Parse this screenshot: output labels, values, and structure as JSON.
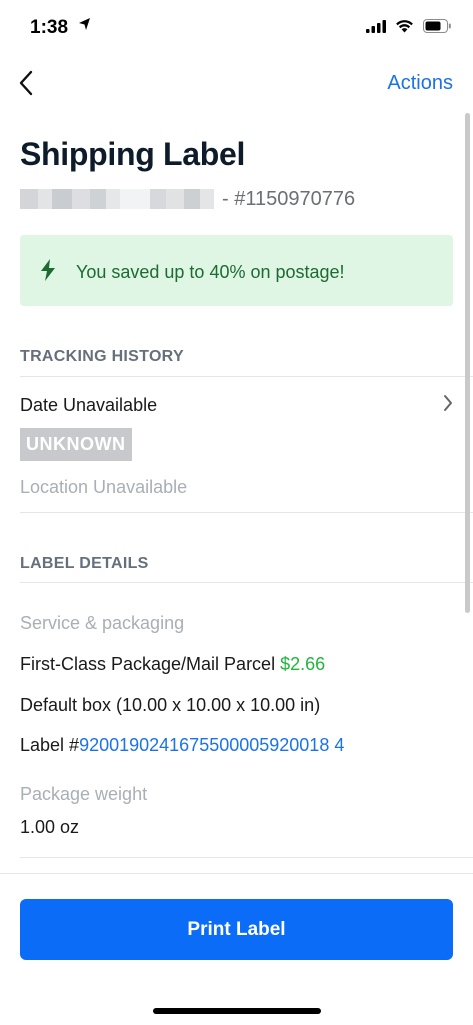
{
  "status_bar": {
    "time": "1:38"
  },
  "nav": {
    "actions_label": "Actions"
  },
  "header": {
    "title": "Shipping Label",
    "order_number": "- #1150970776"
  },
  "banner": {
    "text": "You saved up to 40% on postage!"
  },
  "tracking": {
    "heading": "TRACKING HISTORY",
    "date": "Date Unavailable",
    "status_badge": "UNKNOWN",
    "location": "Location Unavailable"
  },
  "label_details": {
    "heading": "LABEL DETAILS",
    "service_heading": "Service & packaging",
    "service_name": "First-Class Package/Mail Parcel",
    "service_price": "$2.66",
    "box": "Default box (10.00 x 10.00 x 10.00 in)",
    "label_prefix": "Label #",
    "label_number": "9200190241675500005920018 4",
    "weight_heading": "Package weight",
    "weight_value": "1.00 oz"
  },
  "footer": {
    "print_label": "Print Label"
  },
  "colors": {
    "accent": "#0a6cf7",
    "link": "#1a73e8",
    "success": "#1fb63a",
    "banner_bg": "#dff6e4"
  },
  "icons": [
    "location-arrow-icon",
    "cellular-signal-icon",
    "wifi-icon",
    "battery-icon",
    "back-chevron-icon",
    "lightning-bolt-icon",
    "chevron-right-icon"
  ]
}
